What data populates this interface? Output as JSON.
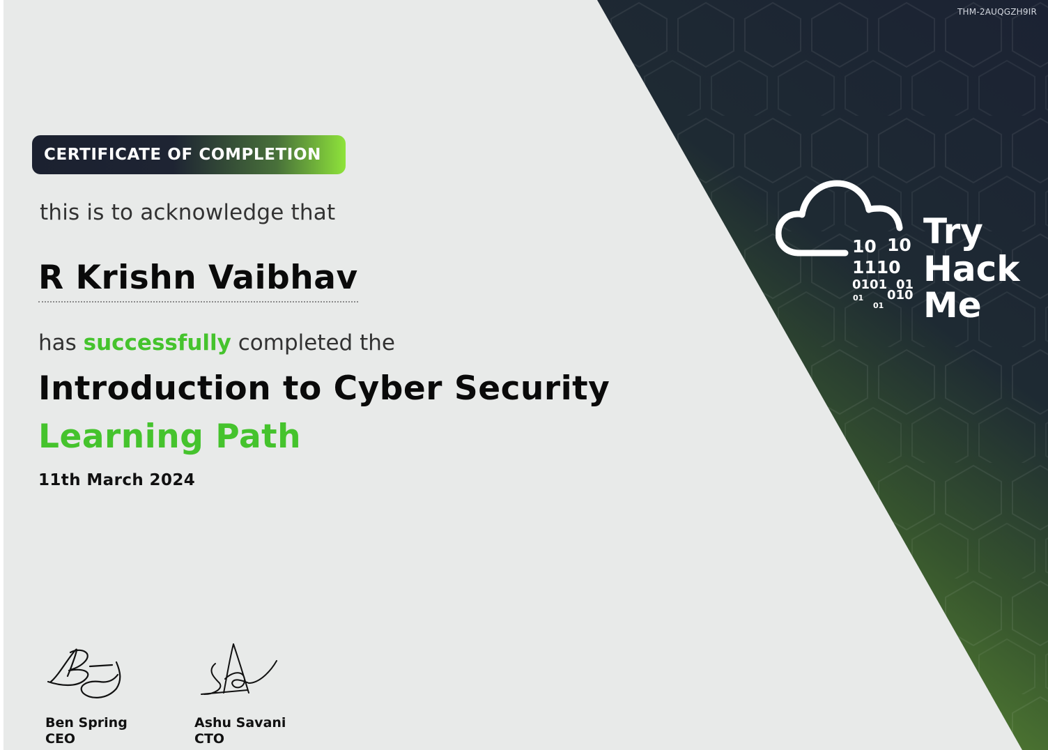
{
  "certificate": {
    "id": "THM-2AUQGZH9IR",
    "badge": "CERTIFICATE OF COMPLETION",
    "acknowledge": "this is to acknowledge that",
    "recipient": "R Krishn Vaibhav",
    "completed_prefix": "has",
    "completed_highlight": "successfully",
    "completed_suffix": "completed the",
    "course_title": "Introduction to Cyber Security",
    "course_type": "Learning Path",
    "date": "11th March 2024"
  },
  "signatories": [
    {
      "name": "Ben Spring",
      "role": "CEO"
    },
    {
      "name": "Ashu Savani",
      "role": "CTO"
    }
  ],
  "logo": {
    "words": [
      "Try",
      "Hack",
      "Me"
    ],
    "binary": [
      "10",
      "10",
      "1110",
      "0101",
      "01",
      "01",
      "01",
      "010"
    ]
  },
  "colors": {
    "background": "#e8eae9",
    "panel_dark": "#1b2233",
    "panel_green": "#5a8a34",
    "accent_green": "#45c32d",
    "text_dark": "#0a0a0a"
  }
}
